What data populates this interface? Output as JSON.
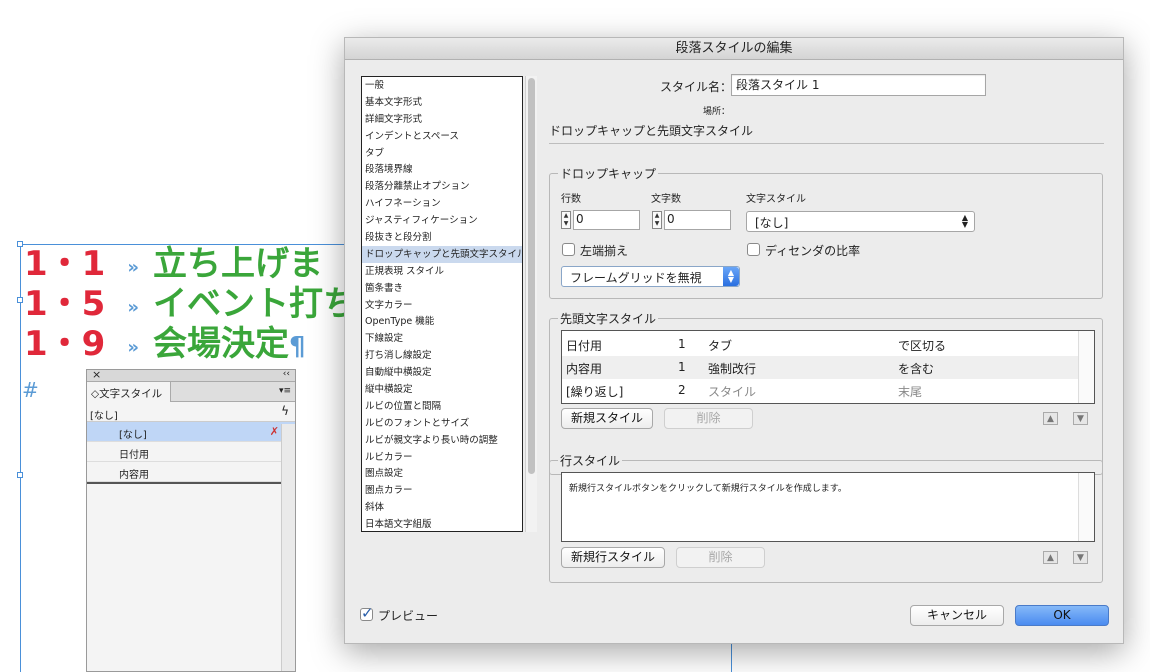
{
  "document": {
    "lines": [
      {
        "num": "1・1",
        "tab": "»",
        "text": "立ち上げま"
      },
      {
        "num": "1・5",
        "tab": "»",
        "text": "イベント打ち"
      },
      {
        "num": "1・9",
        "tab": "»",
        "text": "会場決定",
        "pilcrow": "¶"
      }
    ],
    "hash": "#"
  },
  "char_panel": {
    "close": "×",
    "collapse": "‹‹",
    "tab_label": "◇文字スタイル",
    "menu": "▾≡",
    "current": "[なし]",
    "items": [
      {
        "label": "[なし]",
        "selected": true,
        "icon": "✗"
      },
      {
        "label": "日付用"
      },
      {
        "label": "内容用"
      }
    ]
  },
  "dialog": {
    "title": "段落スタイルの編集",
    "categories": [
      "一般",
      "基本文字形式",
      "詳細文字形式",
      "インデントとスペース",
      "タブ",
      "段落境界線",
      "段落分離禁止オプション",
      "ハイフネーション",
      "ジャスティフィケーション",
      "段抜きと段分割",
      "ドロップキャップと先頭文字スタイル",
      "正規表現 スタイル",
      "箇条書き",
      "文字カラー",
      "OpenType 機能",
      "下線設定",
      "打ち消し線設定",
      "自動縦中横設定",
      "縦中横設定",
      "ルビの位置と間隔",
      "ルビのフォントとサイズ",
      "ルビが親文字より長い時の調整",
      "ルビカラー",
      "圏点設定",
      "圏点カラー",
      "斜体",
      "日本語文字組版"
    ],
    "selected_category_index": 10,
    "style_name_label": "スタイル名：",
    "style_name_value": "段落スタイル 1",
    "location_label": "場所：",
    "section_title": "ドロップキャップと先頭文字スタイル",
    "dropcap": {
      "title": "ドロップキャップ",
      "lines_label": "行数",
      "lines_value": "0",
      "chars_label": "文字数",
      "chars_value": "0",
      "char_style_label": "文字スタイル",
      "char_style_value": "[なし]",
      "align_left_label": "左端揃え",
      "align_left_checked": false,
      "descender_label": "ディセンダの比率",
      "descender_checked": false,
      "grid_option": "フレームグリッドを無視"
    },
    "nested": {
      "title": "先頭文字スタイル",
      "rows": [
        {
          "style": "日付用",
          "count": "1",
          "item": "タブ",
          "mode": "で区切る"
        },
        {
          "style": "内容用",
          "count": "1",
          "item": "強制改行",
          "mode": "を含む"
        },
        {
          "style": "[繰り返し]",
          "count": "2",
          "item": "スタイル",
          "mode": "末尾"
        }
      ],
      "new_button": "新規スタイル",
      "delete_button": "削除"
    },
    "line_style": {
      "title": "行スタイル",
      "hint": "新規行スタイルボタンをクリックして新規行スタイルを作成します。",
      "new_button": "新規行スタイル",
      "delete_button": "削除"
    },
    "preview_label": "プレビュー",
    "preview_checked": true,
    "cancel_button": "キャンセル",
    "ok_button": "OK",
    "up_arrow": "▲",
    "down_arrow": "▼"
  }
}
